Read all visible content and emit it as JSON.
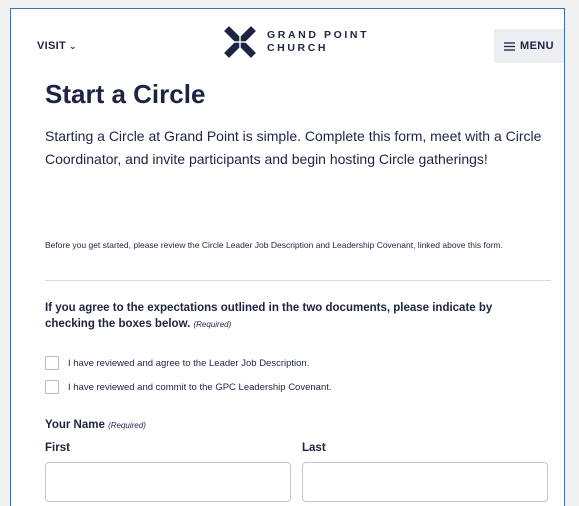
{
  "header": {
    "visit_label": "VISIT",
    "logo_line1": "GRAND POINT",
    "logo_line2": "CHURCH",
    "menu_label": "MENU"
  },
  "page": {
    "title": "Start a Circle",
    "intro": "Starting a Circle at Grand Point is simple. Complete this form, meet with a Circle Coordinator, and invite participants and begin hosting Circle gatherings!",
    "note": "Before you get started, please review the Circle Leader Job Description and Leadership Covenant, linked above this form."
  },
  "form": {
    "agree_label": "If you agree to the expectations outlined in the two documents, please indicate by checking the boxes below.",
    "required_tag": "(Required)",
    "checkboxes": [
      {
        "label": "I have reviewed and agree to the Leader Job Description.",
        "checked": false
      },
      {
        "label": "I have reviewed and commit to the GPC Leadership Covenant.",
        "checked": false
      }
    ],
    "name_label": "Your Name",
    "first_label": "First",
    "last_label": "Last",
    "first_value": "",
    "last_value": ""
  },
  "colors": {
    "navy": "#1d2442",
    "menu_bg": "#eceef2",
    "frame_border": "#3f6fb7"
  },
  "icons": {
    "visit_chevron": "chevron-down-icon",
    "menu": "hamburger-icon",
    "logo": "church-logo-icon"
  }
}
